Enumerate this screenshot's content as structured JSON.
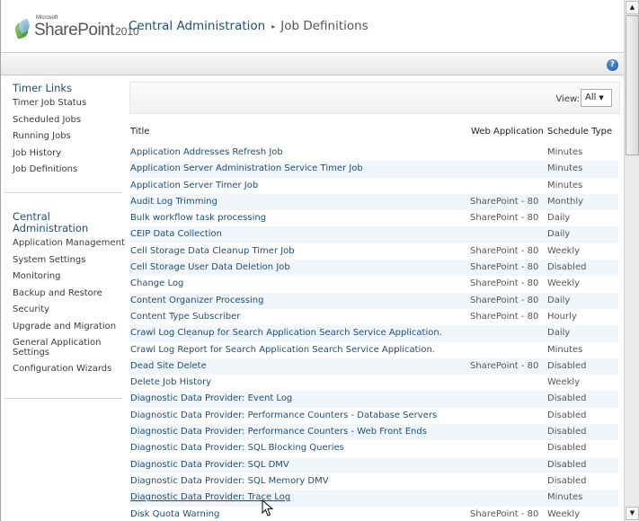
{
  "header": {
    "logo_microsoft": "Microsoft",
    "logo_product": "SharePoint",
    "logo_version": "2010",
    "breadcrumb_root": "Central Administration",
    "breadcrumb_separator": "▸",
    "breadcrumb_current": "Job Definitions"
  },
  "topbar": {
    "help_glyph": "?"
  },
  "leftnav": {
    "group1": {
      "heading": "Timer Links",
      "items": [
        "Timer Job Status",
        "Scheduled Jobs",
        "Running Jobs",
        "Job History",
        "Job Definitions"
      ]
    },
    "group2": {
      "heading": "Central Administration",
      "items": [
        "Application Management",
        "System Settings",
        "Monitoring",
        "Backup and Restore",
        "Security",
        "Upgrade and Migration",
        "General Application Settings",
        "Configuration Wizards"
      ]
    }
  },
  "viewbar": {
    "label": "View:",
    "selected": "All"
  },
  "table": {
    "headers": {
      "title": "Title",
      "web_application": "Web Application",
      "schedule_type": "Schedule Type"
    },
    "rows": [
      {
        "title": "Application Addresses Refresh Job",
        "web": "",
        "schedule": "Minutes"
      },
      {
        "title": "Application Server Administration Service Timer Job",
        "web": "",
        "schedule": "Minutes"
      },
      {
        "title": "Application Server Timer Job",
        "web": "",
        "schedule": "Minutes"
      },
      {
        "title": "Audit Log Trimming",
        "web": "SharePoint - 80",
        "schedule": "Monthly"
      },
      {
        "title": "Bulk workflow task processing",
        "web": "SharePoint - 80",
        "schedule": "Daily"
      },
      {
        "title": "CEIP Data Collection",
        "web": "",
        "schedule": "Daily"
      },
      {
        "title": "Cell Storage Data Cleanup Timer Job",
        "web": "SharePoint - 80",
        "schedule": "Weekly"
      },
      {
        "title": "Cell Storage User Data Deletion Job",
        "web": "SharePoint - 80",
        "schedule": "Disabled"
      },
      {
        "title": "Change Log",
        "web": "SharePoint - 80",
        "schedule": "Weekly"
      },
      {
        "title": "Content Organizer Processing",
        "web": "SharePoint - 80",
        "schedule": "Daily"
      },
      {
        "title": "Content Type Subscriber",
        "web": "SharePoint - 80",
        "schedule": "Hourly"
      },
      {
        "title": "Crawl Log Cleanup for Search Application Search Service Application.",
        "web": "",
        "schedule": "Daily"
      },
      {
        "title": "Crawl Log Report for Search Application Search Service Application.",
        "web": "",
        "schedule": "Minutes"
      },
      {
        "title": "Dead Site Delete",
        "web": "SharePoint - 80",
        "schedule": "Disabled"
      },
      {
        "title": "Delete Job History",
        "web": "",
        "schedule": "Weekly"
      },
      {
        "title": "Diagnostic Data Provider: Event Log",
        "web": "",
        "schedule": "Disabled"
      },
      {
        "title": "Diagnostic Data Provider: Performance Counters - Database Servers",
        "web": "",
        "schedule": "Disabled"
      },
      {
        "title": "Diagnostic Data Provider: Performance Counters - Web Front Ends",
        "web": "",
        "schedule": "Disabled"
      },
      {
        "title": "Diagnostic Data Provider: SQL Blocking Queries",
        "web": "",
        "schedule": "Disabled"
      },
      {
        "title": "Diagnostic Data Provider: SQL DMV",
        "web": "",
        "schedule": "Disabled"
      },
      {
        "title": "Diagnostic Data Provider: SQL Memory DMV",
        "web": "",
        "schedule": "Disabled"
      },
      {
        "title": "Diagnostic Data Provider: Trace Log",
        "web": "",
        "schedule": "Minutes"
      },
      {
        "title": "Disk Quota Warning",
        "web": "SharePoint - 80",
        "schedule": "Weekly"
      }
    ]
  },
  "scrollbar": {
    "up_glyph": "▲",
    "down_glyph": "▼"
  }
}
